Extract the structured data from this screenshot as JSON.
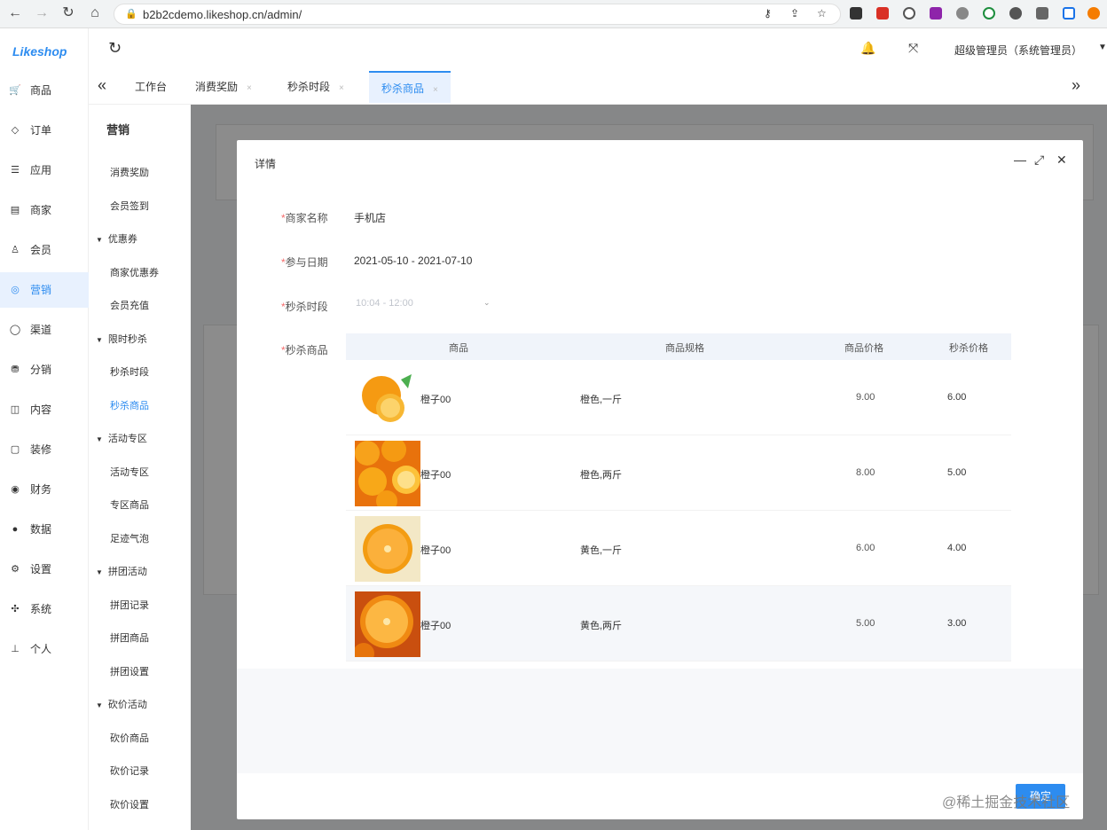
{
  "browser": {
    "url": "b2b2cdemo.likeshop.cn/admin/"
  },
  "app": {
    "logo": "Likeshop"
  },
  "rail": {
    "items": [
      {
        "icon": "🛒",
        "label": "商品"
      },
      {
        "icon": "◇",
        "label": "订单"
      },
      {
        "icon": "☰",
        "label": "应用"
      },
      {
        "icon": "▤",
        "label": "商家"
      },
      {
        "icon": "♙",
        "label": "会员"
      },
      {
        "icon": "◎",
        "label": "营销"
      },
      {
        "icon": "◯",
        "label": "渠道"
      },
      {
        "icon": "⛃",
        "label": "分销"
      },
      {
        "icon": "◫",
        "label": "内容"
      },
      {
        "icon": "▢",
        "label": "装修"
      },
      {
        "icon": "◉",
        "label": "财务"
      },
      {
        "icon": "●",
        "label": "数据"
      },
      {
        "icon": "⚙",
        "label": "设置"
      },
      {
        "icon": "✣",
        "label": "系统"
      },
      {
        "icon": "⊥",
        "label": "个人"
      }
    ]
  },
  "header": {
    "user": "超级管理员（系统管理员）"
  },
  "tabs": [
    {
      "label": "工作台"
    },
    {
      "label": "消费奖励"
    },
    {
      "label": "秒杀时段"
    },
    {
      "label": "秒杀商品"
    }
  ],
  "submenu": {
    "title": "营销",
    "entries": [
      {
        "type": "item",
        "label": "消费奖励"
      },
      {
        "type": "item",
        "label": "会员签到"
      },
      {
        "type": "group",
        "label": "优惠券"
      },
      {
        "type": "item",
        "label": "商家优惠券"
      },
      {
        "type": "item",
        "label": "会员充值"
      },
      {
        "type": "group",
        "label": "限时秒杀"
      },
      {
        "type": "item",
        "label": "秒杀时段"
      },
      {
        "type": "item",
        "label": "秒杀商品"
      },
      {
        "type": "group",
        "label": "活动专区"
      },
      {
        "type": "item",
        "label": "活动专区"
      },
      {
        "type": "item",
        "label": "专区商品"
      },
      {
        "type": "item",
        "label": "足迹气泡"
      },
      {
        "type": "group",
        "label": "拼团活动"
      },
      {
        "type": "item",
        "label": "拼团记录"
      },
      {
        "type": "item",
        "label": "拼团商品"
      },
      {
        "type": "item",
        "label": "拼团设置"
      },
      {
        "type": "group",
        "label": "砍价活动"
      },
      {
        "type": "item",
        "label": "砍价商品"
      },
      {
        "type": "item",
        "label": "砍价记录"
      },
      {
        "type": "item",
        "label": "砍价设置"
      }
    ]
  },
  "modal": {
    "title": "详情",
    "fields": {
      "shop_label": "商家名称",
      "shop_value": "手机店",
      "date_label": "参与日期",
      "date_value": "2021-05-10 - 2021-07-10",
      "period_label": "秒杀时段",
      "period_value": "10:04 - 12:00",
      "goods_label": "秒杀商品"
    },
    "table": {
      "headers": [
        "商品",
        "商品规格",
        "商品价格",
        "秒杀价格"
      ],
      "rows": [
        {
          "name": "橙子00",
          "spec": "橙色,一斤",
          "price": "9.00",
          "seckill": "6.00"
        },
        {
          "name": "橙子00",
          "spec": "橙色,两斤",
          "price": "8.00",
          "seckill": "5.00"
        },
        {
          "name": "橙子00",
          "spec": "黄色,一斤",
          "price": "6.00",
          "seckill": "4.00"
        },
        {
          "name": "橙子00",
          "spec": "黄色,两斤",
          "price": "5.00",
          "seckill": "3.00"
        }
      ]
    },
    "ok_label": "确定"
  },
  "watermark": "@稀土掘金技术社区",
  "colors": {
    "primary": "#2d8cf0",
    "active_bg": "#e8f1fe"
  }
}
